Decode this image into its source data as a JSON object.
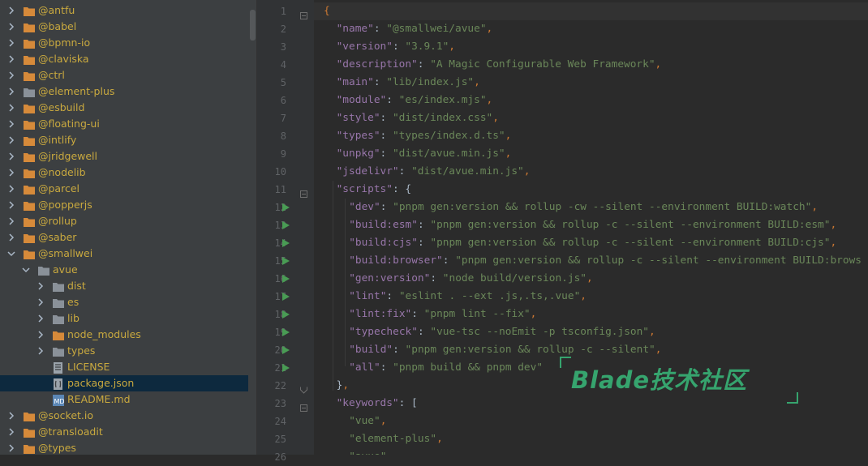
{
  "tree": {
    "items": [
      {
        "label": "@antfu",
        "depth": 0,
        "type": "folder",
        "expanded": false
      },
      {
        "label": "@babel",
        "depth": 0,
        "type": "folder",
        "expanded": false
      },
      {
        "label": "@bpmn-io",
        "depth": 0,
        "type": "folder",
        "expanded": false
      },
      {
        "label": "@claviska",
        "depth": 0,
        "type": "folder",
        "expanded": false
      },
      {
        "label": "@ctrl",
        "depth": 0,
        "type": "folder",
        "expanded": false
      },
      {
        "label": "@element-plus",
        "depth": 0,
        "type": "folder-grey",
        "expanded": false
      },
      {
        "label": "@esbuild",
        "depth": 0,
        "type": "folder",
        "expanded": false
      },
      {
        "label": "@floating-ui",
        "depth": 0,
        "type": "folder",
        "expanded": false
      },
      {
        "label": "@intlify",
        "depth": 0,
        "type": "folder",
        "expanded": false
      },
      {
        "label": "@jridgewell",
        "depth": 0,
        "type": "folder",
        "expanded": false
      },
      {
        "label": "@nodelib",
        "depth": 0,
        "type": "folder",
        "expanded": false
      },
      {
        "label": "@parcel",
        "depth": 0,
        "type": "folder",
        "expanded": false
      },
      {
        "label": "@popperjs",
        "depth": 0,
        "type": "folder",
        "expanded": false
      },
      {
        "label": "@rollup",
        "depth": 0,
        "type": "folder",
        "expanded": false
      },
      {
        "label": "@saber",
        "depth": 0,
        "type": "folder",
        "expanded": false
      },
      {
        "label": "@smallwei",
        "depth": 0,
        "type": "folder",
        "expanded": true
      },
      {
        "label": "avue",
        "depth": 1,
        "type": "folder-grey",
        "expanded": true
      },
      {
        "label": "dist",
        "depth": 2,
        "type": "folder-grey",
        "expanded": false
      },
      {
        "label": "es",
        "depth": 2,
        "type": "folder-grey",
        "expanded": false
      },
      {
        "label": "lib",
        "depth": 2,
        "type": "folder-grey",
        "expanded": false
      },
      {
        "label": "node_modules",
        "depth": 2,
        "type": "folder",
        "expanded": false
      },
      {
        "label": "types",
        "depth": 2,
        "type": "folder-grey",
        "expanded": false
      },
      {
        "label": "LICENSE",
        "depth": 2,
        "type": "file-text"
      },
      {
        "label": "package.json",
        "depth": 2,
        "type": "file-json",
        "selected": true
      },
      {
        "label": "README.md",
        "depth": 2,
        "type": "file-md"
      },
      {
        "label": "@socket.io",
        "depth": 0,
        "type": "folder",
        "expanded": false
      },
      {
        "label": "@transloadit",
        "depth": 0,
        "type": "folder",
        "expanded": false
      },
      {
        "label": "@types",
        "depth": 0,
        "type": "folder",
        "expanded": false
      }
    ]
  },
  "editor": {
    "lines": [
      {
        "n": "1",
        "fold": "open",
        "run": false,
        "indent": 0,
        "tokens": [
          [
            "p",
            "{"
          ]
        ]
      },
      {
        "n": "2",
        "indent": 1,
        "tokens": [
          [
            "k",
            "\"name\""
          ],
          [
            "b",
            ": "
          ],
          [
            "s",
            "\"@smallwei/avue\""
          ],
          [
            "p",
            ","
          ]
        ]
      },
      {
        "n": "3",
        "indent": 1,
        "tokens": [
          [
            "k",
            "\"version\""
          ],
          [
            "b",
            ": "
          ],
          [
            "s",
            "\"3.9.1\""
          ],
          [
            "p",
            ","
          ]
        ]
      },
      {
        "n": "4",
        "indent": 1,
        "tokens": [
          [
            "k",
            "\"description\""
          ],
          [
            "b",
            ": "
          ],
          [
            "s",
            "\"A Magic Configurable Web Framework\""
          ],
          [
            "p",
            ","
          ]
        ]
      },
      {
        "n": "5",
        "indent": 1,
        "tokens": [
          [
            "k",
            "\"main\""
          ],
          [
            "b",
            ": "
          ],
          [
            "s",
            "\"lib/index.js\""
          ],
          [
            "p",
            ","
          ]
        ]
      },
      {
        "n": "6",
        "indent": 1,
        "tokens": [
          [
            "k",
            "\"module\""
          ],
          [
            "b",
            ": "
          ],
          [
            "s",
            "\"es/index.mjs\""
          ],
          [
            "p",
            ","
          ]
        ]
      },
      {
        "n": "7",
        "indent": 1,
        "tokens": [
          [
            "k",
            "\"style\""
          ],
          [
            "b",
            ": "
          ],
          [
            "s",
            "\"dist/index.css\""
          ],
          [
            "p",
            ","
          ]
        ]
      },
      {
        "n": "8",
        "indent": 1,
        "tokens": [
          [
            "k",
            "\"types\""
          ],
          [
            "b",
            ": "
          ],
          [
            "s",
            "\"types/index.d.ts\""
          ],
          [
            "p",
            ","
          ]
        ]
      },
      {
        "n": "9",
        "indent": 1,
        "tokens": [
          [
            "k",
            "\"unpkg\""
          ],
          [
            "b",
            ": "
          ],
          [
            "s",
            "\"dist/avue.min.js\""
          ],
          [
            "p",
            ","
          ]
        ]
      },
      {
        "n": "10",
        "indent": 1,
        "tokens": [
          [
            "k",
            "\"jsdelivr\""
          ],
          [
            "b",
            ": "
          ],
          [
            "s",
            "\"dist/avue.min.js\""
          ],
          [
            "p",
            ","
          ]
        ]
      },
      {
        "n": "11",
        "fold": "open",
        "indent": 1,
        "tokens": [
          [
            "k",
            "\"scripts\""
          ],
          [
            "b",
            ": {"
          ]
        ]
      },
      {
        "n": "12",
        "run": true,
        "indent": 2,
        "tokens": [
          [
            "k",
            "\"dev\""
          ],
          [
            "b",
            ": "
          ],
          [
            "s",
            "\"pnpm gen:version && rollup -cw --silent --environment BUILD:watch\""
          ],
          [
            "p",
            ","
          ]
        ]
      },
      {
        "n": "13",
        "run": true,
        "indent": 2,
        "tokens": [
          [
            "k",
            "\"build:esm\""
          ],
          [
            "b",
            ": "
          ],
          [
            "s",
            "\"pnpm gen:version && rollup -c --silent --environment BUILD:esm\""
          ],
          [
            "p",
            ","
          ]
        ]
      },
      {
        "n": "14",
        "run": true,
        "indent": 2,
        "tokens": [
          [
            "k",
            "\"build:cjs\""
          ],
          [
            "b",
            ": "
          ],
          [
            "s",
            "\"pnpm gen:version && rollup -c --silent --environment BUILD:cjs\""
          ],
          [
            "p",
            ","
          ]
        ]
      },
      {
        "n": "15",
        "run": true,
        "indent": 2,
        "tokens": [
          [
            "k",
            "\"build:browser\""
          ],
          [
            "b",
            ": "
          ],
          [
            "s",
            "\"pnpm gen:version && rollup -c --silent --environment BUILD:brows"
          ]
        ]
      },
      {
        "n": "16",
        "run": true,
        "indent": 2,
        "tokens": [
          [
            "k",
            "\"gen:version\""
          ],
          [
            "b",
            ": "
          ],
          [
            "s",
            "\"node build/version.js\""
          ],
          [
            "p",
            ","
          ]
        ]
      },
      {
        "n": "17",
        "run": true,
        "indent": 2,
        "tokens": [
          [
            "k",
            "\"lint\""
          ],
          [
            "b",
            ": "
          ],
          [
            "s",
            "\"eslint . --ext .js,.ts,.vue\""
          ],
          [
            "p",
            ","
          ]
        ]
      },
      {
        "n": "18",
        "run": true,
        "indent": 2,
        "tokens": [
          [
            "k",
            "\"lint:fix\""
          ],
          [
            "b",
            ": "
          ],
          [
            "s",
            "\"pnpm lint --fix\""
          ],
          [
            "p",
            ","
          ]
        ]
      },
      {
        "n": "19",
        "run": true,
        "indent": 2,
        "tokens": [
          [
            "k",
            "\"typecheck\""
          ],
          [
            "b",
            ": "
          ],
          [
            "s",
            "\"vue-tsc --noEmit -p tsconfig.json\""
          ],
          [
            "p",
            ","
          ]
        ]
      },
      {
        "n": "20",
        "run": true,
        "indent": 2,
        "tokens": [
          [
            "k",
            "\"build\""
          ],
          [
            "b",
            ": "
          ],
          [
            "s",
            "\"pnpm gen:version && rollup -c --silent\""
          ],
          [
            "p",
            ","
          ]
        ]
      },
      {
        "n": "21",
        "run": true,
        "indent": 2,
        "tokens": [
          [
            "k",
            "\"all\""
          ],
          [
            "b",
            ": "
          ],
          [
            "s",
            "\"pnpm build && pnpm dev\""
          ]
        ]
      },
      {
        "n": "22",
        "fold": "close",
        "indent": 1,
        "tokens": [
          [
            "b",
            "}"
          ],
          [
            "p",
            ","
          ]
        ]
      },
      {
        "n": "23",
        "fold": "open",
        "indent": 1,
        "tokens": [
          [
            "k",
            "\"keywords\""
          ],
          [
            "b",
            ": ["
          ]
        ]
      },
      {
        "n": "24",
        "indent": 2,
        "tokens": [
          [
            "s",
            "\"vue\""
          ],
          [
            "p",
            ","
          ]
        ]
      },
      {
        "n": "25",
        "indent": 2,
        "tokens": [
          [
            "s",
            "\"element-plus\""
          ],
          [
            "p",
            ","
          ]
        ]
      },
      {
        "n": "26",
        "indent": 2,
        "tokens": [
          [
            "s",
            "\"avue\""
          ],
          [
            "p",
            ","
          ]
        ]
      }
    ]
  },
  "watermark": {
    "text": "Blade技术社区"
  },
  "colors": {
    "folder": "#d68a3a",
    "folder_grey": "#8a9199",
    "label": "#c9a93f",
    "run": "#499c54",
    "watermark": "#36a46e"
  }
}
